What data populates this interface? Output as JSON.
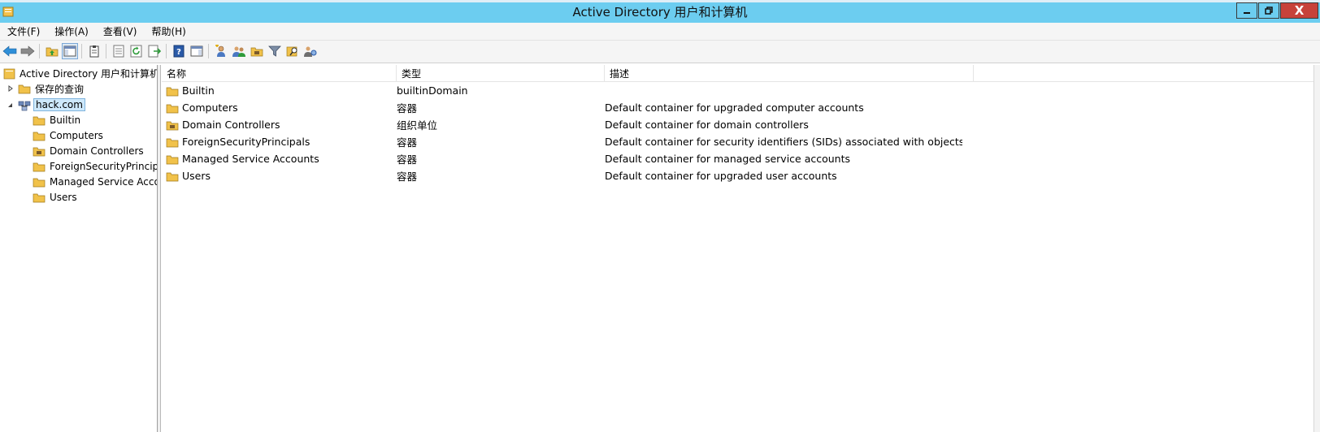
{
  "window": {
    "title": "Active Directory 用户和计算机",
    "close_glyph": "X"
  },
  "menu": [
    {
      "label": "文件(F)"
    },
    {
      "label": "操作(A)"
    },
    {
      "label": "查看(V)"
    },
    {
      "label": "帮助(H)"
    }
  ],
  "toolbar": {
    "icons": [
      "back-arrow-icon",
      "forward-arrow-icon",
      "up-folder-icon",
      "show-hide-console-tree-icon",
      "clipboard-icon",
      "properties-icon",
      "refresh-icon",
      "export-list-icon",
      "help-icon",
      "show-hide-action-pane-icon",
      "new-user-icon",
      "new-group-icon",
      "new-ou-icon",
      "filter-icon",
      "find-icon",
      "add-to-group-icon"
    ]
  },
  "tree": {
    "root": "Active Directory 用户和计算机",
    "saved_queries": "保存的查询",
    "domain": "hack.com",
    "children": [
      {
        "label": "Builtin",
        "icon": "folder-icon"
      },
      {
        "label": "Computers",
        "icon": "folder-icon"
      },
      {
        "label": "Domain Controllers",
        "icon": "ou-folder-icon"
      },
      {
        "label": "ForeignSecurityPrincipals",
        "icon": "folder-icon"
      },
      {
        "label": "Managed Service Accounts",
        "icon": "folder-icon"
      },
      {
        "label": "Users",
        "icon": "folder-icon"
      }
    ]
  },
  "list": {
    "columns": {
      "name": "名称",
      "type": "类型",
      "description": "描述"
    },
    "rows": [
      {
        "name": "Builtin",
        "type": "builtinDomain",
        "description": "",
        "icon": "folder-icon"
      },
      {
        "name": "Computers",
        "type": "容器",
        "description": "Default container for upgraded computer accounts",
        "icon": "folder-icon"
      },
      {
        "name": "Domain Controllers",
        "type": "组织单位",
        "description": "Default container for domain controllers",
        "icon": "ou-folder-icon"
      },
      {
        "name": "ForeignSecurityPrincipals",
        "type": "容器",
        "description": "Default container for security identifiers (SIDs) associated with objects fro...",
        "icon": "folder-icon"
      },
      {
        "name": "Managed Service Accounts",
        "type": "容器",
        "description": "Default container for managed service accounts",
        "icon": "folder-icon"
      },
      {
        "name": "Users",
        "type": "容器",
        "description": "Default container for upgraded user accounts",
        "icon": "folder-icon"
      }
    ]
  },
  "colors": {
    "titlebar": "#6ccdf0",
    "close_button": "#c7423a",
    "selection": "#cde8fb"
  }
}
